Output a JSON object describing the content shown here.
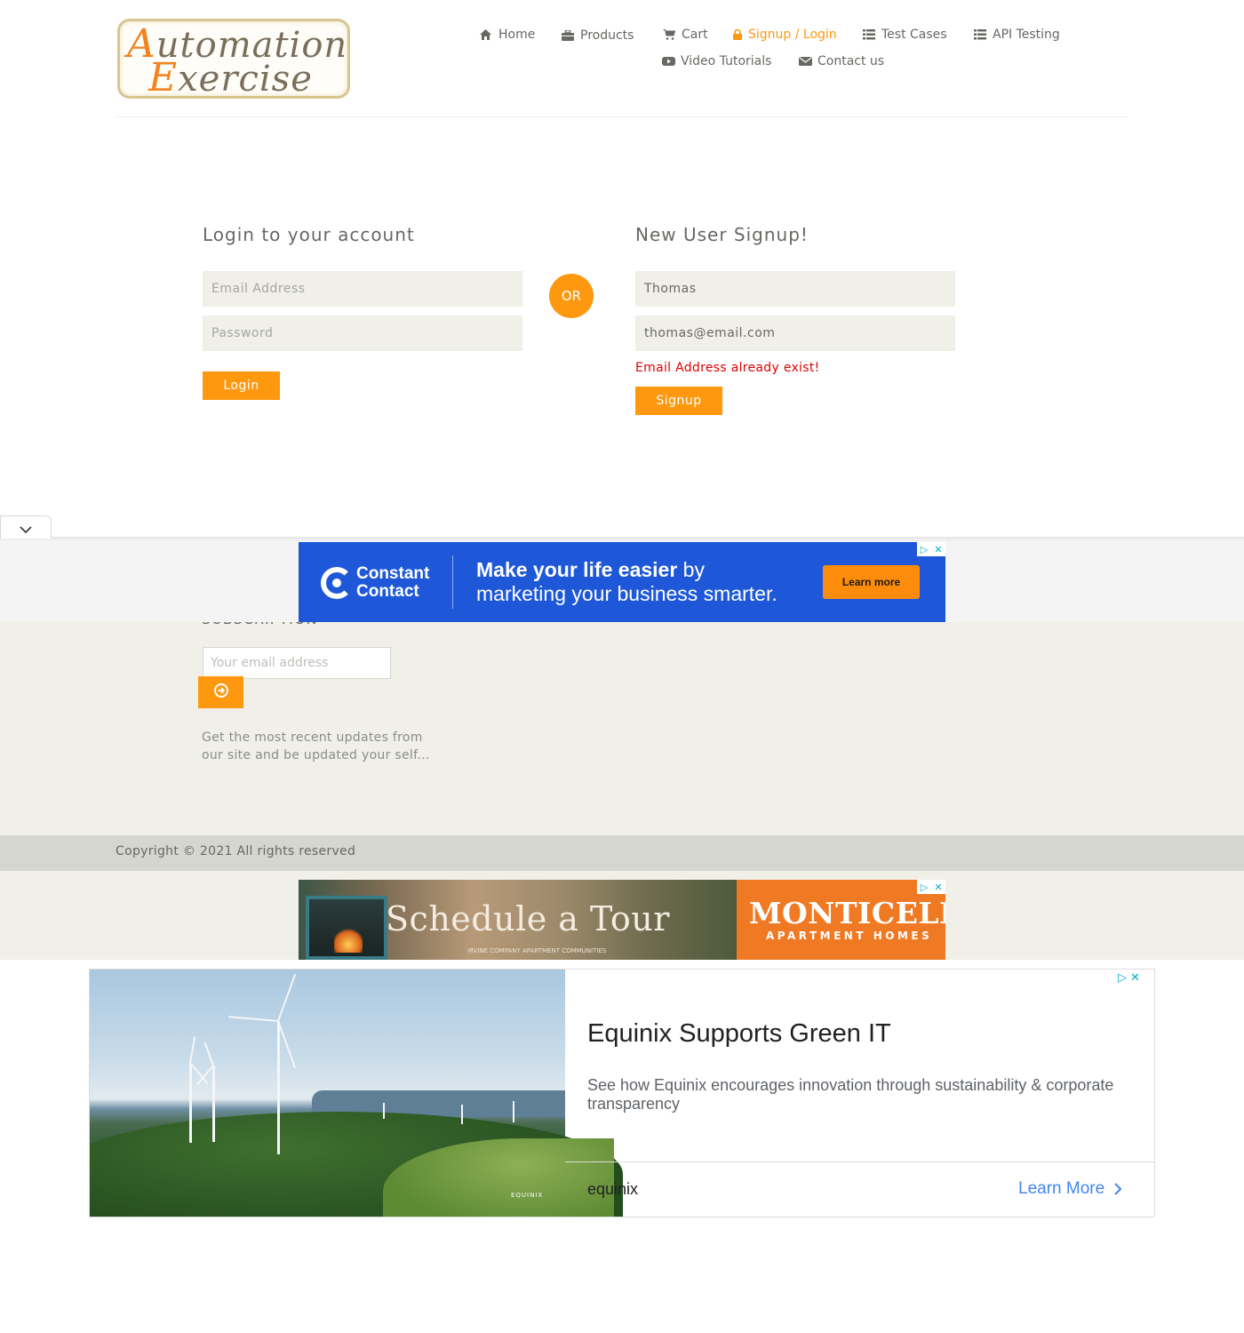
{
  "logo": {
    "line1_cap": "A",
    "line1_rest": "utomation",
    "line2_cap": "E",
    "line2_rest": "xercise"
  },
  "nav": {
    "home": {
      "label": "Home",
      "icon": "home-icon"
    },
    "products": {
      "label": "Products",
      "icon": "briefcase-icon"
    },
    "cart": {
      "label": "Cart",
      "icon": "cart-icon"
    },
    "signup_login": {
      "label": "Signup / Login",
      "icon": "lock-icon",
      "active": true
    },
    "test_cases": {
      "label": "Test Cases",
      "icon": "list-icon"
    },
    "api_testing": {
      "label": "API Testing",
      "icon": "list-icon"
    },
    "video_tutorials": {
      "label": "Video Tutorials",
      "icon": "youtube-play-icon"
    },
    "contact_us": {
      "label": "Contact us",
      "icon": "envelope-icon"
    }
  },
  "login": {
    "title": "Login to your account",
    "email_placeholder": "Email Address",
    "password_placeholder": "Password",
    "button": "Login"
  },
  "or_label": "OR",
  "signup": {
    "title": "New User Signup!",
    "name_value": "Thomas",
    "email_value": "thomas@email.com",
    "error": "Email Address already exist!",
    "button": "Signup"
  },
  "ad_constant_contact": {
    "brand_line1": "Constant",
    "brand_line2": "Contact",
    "headline_bold": "Make your life easier",
    "headline_rest": " by",
    "headline_line2": "marketing your business smarter.",
    "cta": "Learn more"
  },
  "subscription": {
    "title": "SUBSCRIPTION",
    "placeholder": "Your email address",
    "description": "Get the most recent updates from our site and be updated your self..."
  },
  "footer": {
    "copyright": "Copyright © 2021 All rights reserved"
  },
  "ad_monticello": {
    "tagline": "Schedule a Tour",
    "brand": "MONTICELLO",
    "subtitle": "APARTMENT HOMES",
    "fine_print": "IRVINE COMPANY APARTMENT COMMUNITIES"
  },
  "ad_equinix": {
    "title": "Equinix Supports Green IT",
    "description": "See how Equinix encourages innovation through sustainability & corporate transparency",
    "brand": "equinix",
    "cta": "Learn More",
    "watermark": "EQUINIX"
  },
  "colors": {
    "accent": "#fe980f",
    "error": "#e00000",
    "footer_bg": "#f0f0e9",
    "footer_bottom": "#d6d6d0"
  }
}
